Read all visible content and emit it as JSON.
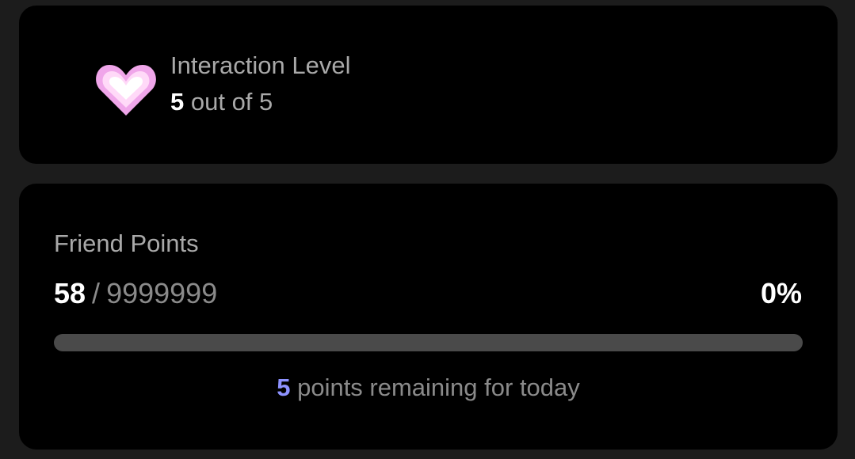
{
  "interaction": {
    "label": "Interaction Level",
    "current": "5",
    "suffix": " out of 5",
    "icon": "heart-icon"
  },
  "friend_points": {
    "label": "Friend Points",
    "current": "58",
    "separator": "/",
    "max": "9999999",
    "percent_text": "0%",
    "progress": 0.0,
    "remaining_count": "5",
    "remaining_text": " points remaining for today"
  },
  "colors": {
    "background": "#1c1c1c",
    "card": "#000000",
    "accent": "#8d92ff",
    "track": "#4a4a4a",
    "heart_outer": "#f0a6ea",
    "heart_inner": "#ffffff"
  }
}
